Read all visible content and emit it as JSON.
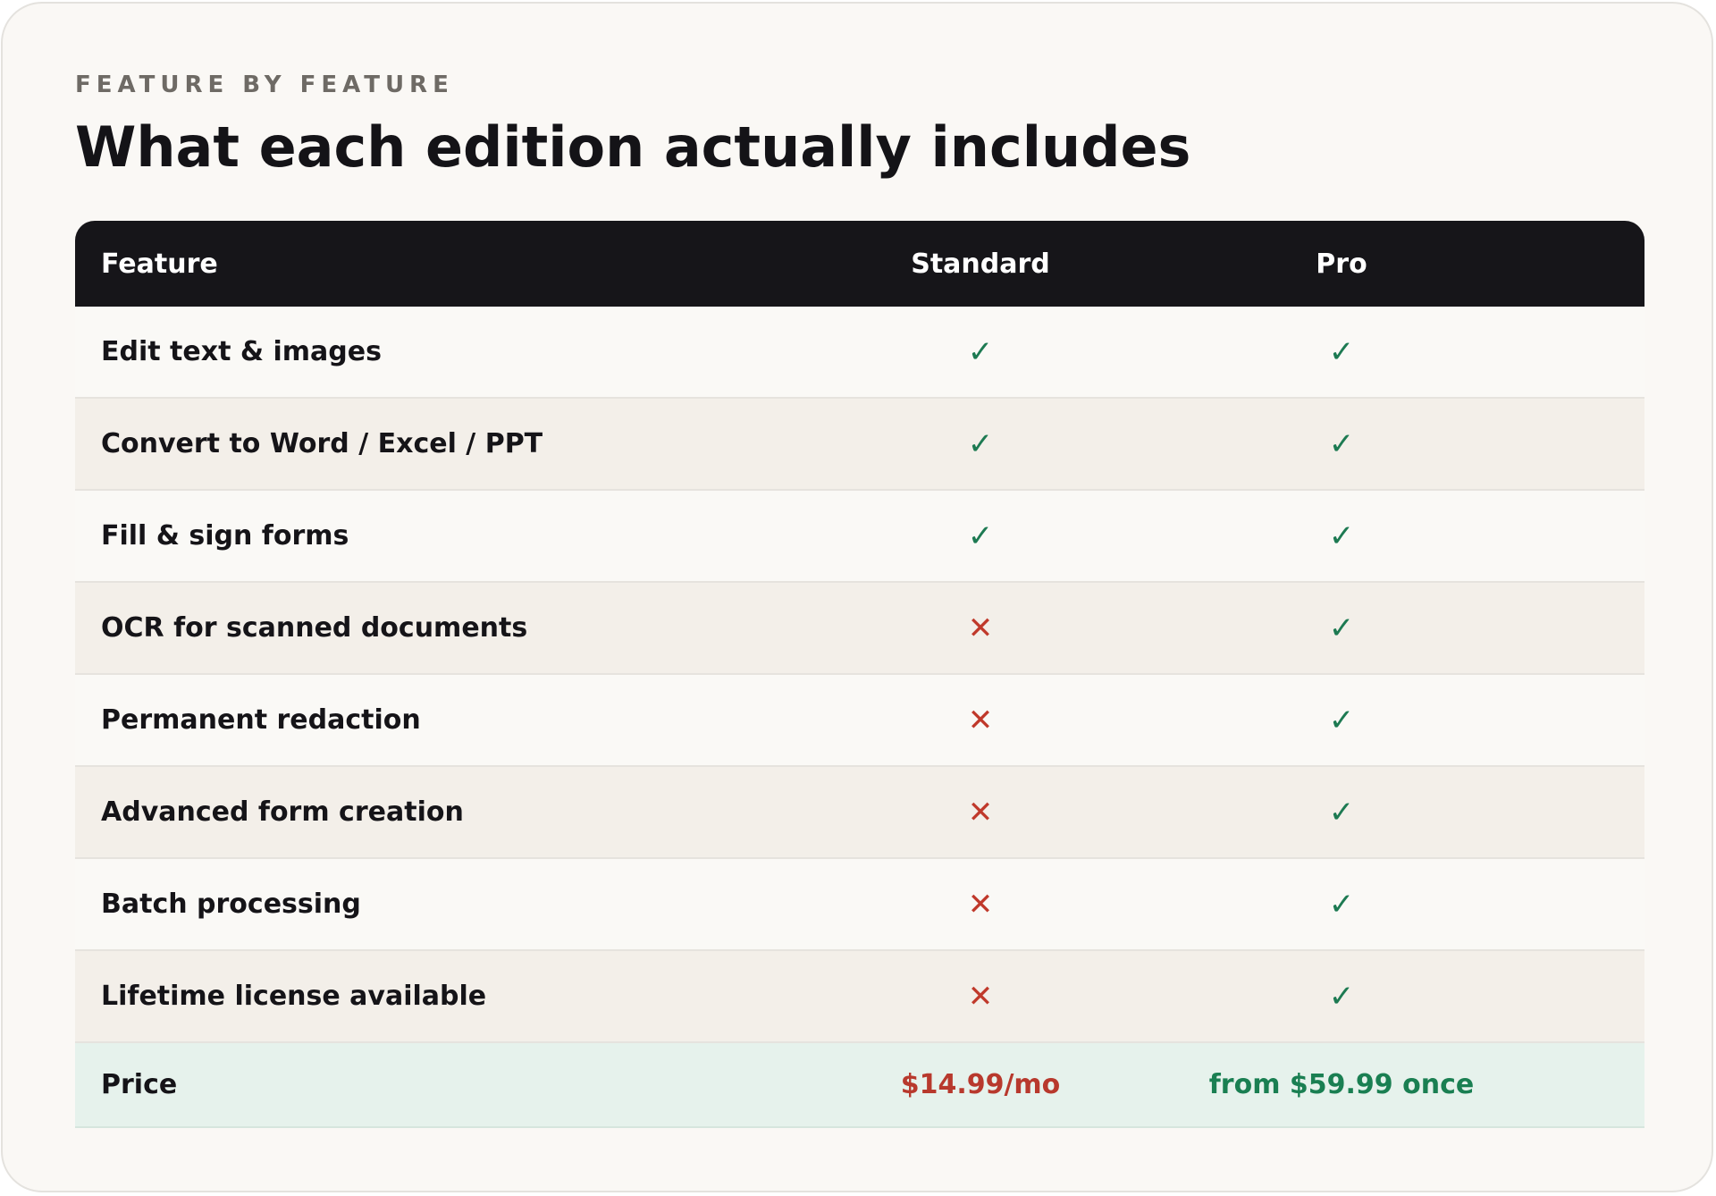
{
  "header": {
    "eyebrow": "FEATURE BY FEATURE",
    "title": "What each edition actually includes"
  },
  "table": {
    "columns": [
      "Feature",
      "Standard",
      "Pro"
    ],
    "rows": [
      {
        "feature": "Edit text & images",
        "standard": "✓",
        "pro": "✓"
      },
      {
        "feature": "Convert to Word / Excel / PPT",
        "standard": "✓",
        "pro": "✓"
      },
      {
        "feature": "Fill & sign forms",
        "standard": "✓",
        "pro": "✓"
      },
      {
        "feature": "OCR for scanned documents",
        "standard": "✕",
        "pro": "✓"
      },
      {
        "feature": "Permanent redaction",
        "standard": "✕",
        "pro": "✓"
      },
      {
        "feature": "Advanced form creation",
        "standard": "✕",
        "pro": "✓"
      },
      {
        "feature": "Batch processing",
        "standard": "✕",
        "pro": "✓"
      },
      {
        "feature": "Lifetime license available",
        "standard": "✕",
        "pro": "✓"
      }
    ],
    "price": {
      "label": "Price",
      "standard": "$14.99/mo",
      "pro": "from $59.99 once"
    }
  },
  "colors": {
    "included": "#1d7a52",
    "excluded": "#c0392b",
    "header_bg": "#161519",
    "price_row_bg": "#e6f2ec"
  }
}
